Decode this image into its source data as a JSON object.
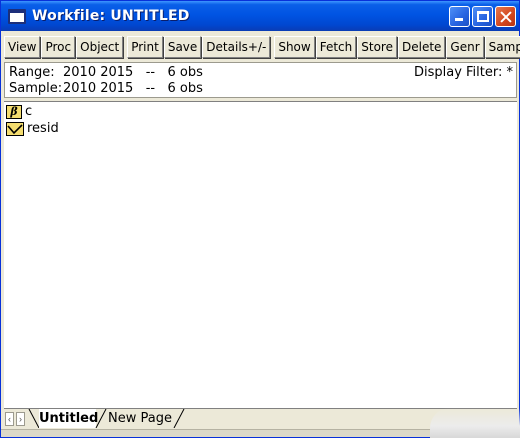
{
  "window": {
    "title": "Workfile: UNTITLED",
    "title_bar_color": "#0054e3",
    "close_color": "#d2461d"
  },
  "toolbar": {
    "buttons": [
      "View",
      "Proc",
      "Object",
      "Print",
      "Save",
      "Details+/-",
      "Show",
      "Fetch",
      "Store",
      "Delete",
      "Genr",
      "Sample"
    ]
  },
  "info": {
    "range_label": "Range:",
    "range_value": "2010 2015   --   6 obs",
    "sample_label": "Sample:",
    "sample_value": "2010 2015   --   6 obs",
    "display_filter": "Display Filter: *"
  },
  "objects": [
    {
      "name": "c",
      "icon": "coefficient-beta-icon",
      "glyph": "β"
    },
    {
      "name": "resid",
      "icon": "series-line-icon"
    }
  ],
  "tabs": {
    "active": "Untitled",
    "other": "New Page",
    "prev_arrow": "‹",
    "next_arrow": "›"
  }
}
